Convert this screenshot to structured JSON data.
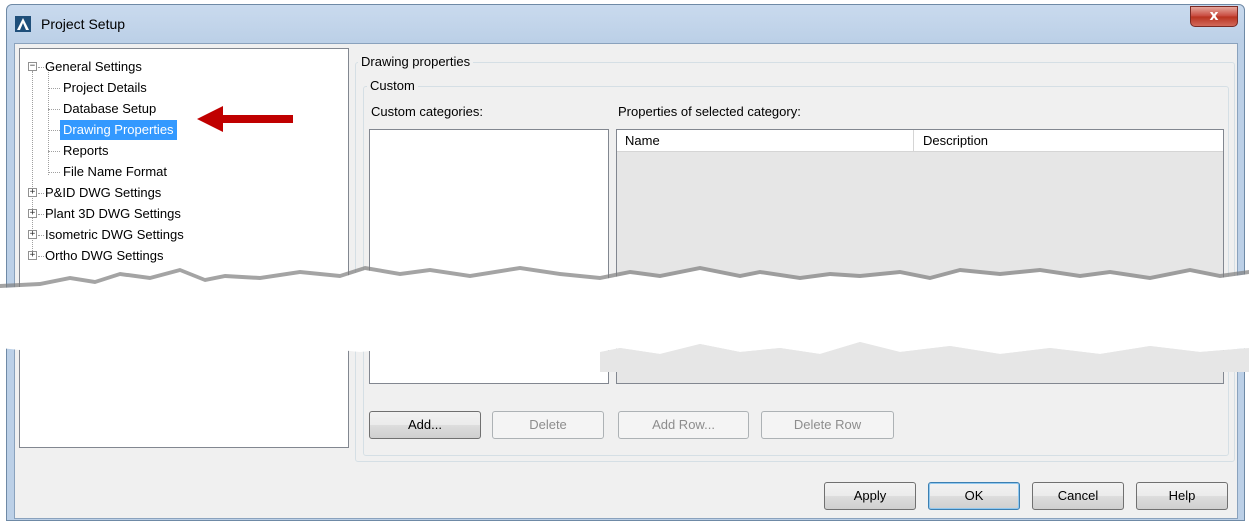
{
  "window": {
    "title": "Project Setup",
    "close_label": "x",
    "app_icon": "autocad-icon",
    "close_icon": "close-icon"
  },
  "tree": {
    "items": [
      {
        "label": "General Settings",
        "level": 0,
        "expander": "−"
      },
      {
        "label": "Project Details",
        "level": 1
      },
      {
        "label": "Database Setup",
        "level": 1
      },
      {
        "label": "Drawing Properties",
        "level": 1,
        "selected": true
      },
      {
        "label": "Reports",
        "level": 1
      },
      {
        "label": "File Name Format",
        "level": 1
      },
      {
        "label": "P&ID DWG Settings",
        "level": 0,
        "expander": "+"
      },
      {
        "label": "Plant 3D DWG Settings",
        "level": 0,
        "expander": "+"
      },
      {
        "label": "Isometric DWG Settings",
        "level": 0,
        "expander": "+"
      },
      {
        "label": "Ortho DWG Settings",
        "level": 0,
        "expander": "+"
      }
    ]
  },
  "annotation": {
    "arrow_color": "#c00000",
    "arrow_icon": "red-arrow-icon"
  },
  "panel": {
    "title": "Drawing properties",
    "group": "Custom",
    "categories_label": "Custom categories:",
    "properties_label": "Properties of selected category:",
    "columns": [
      "Name",
      "Description"
    ]
  },
  "buttons": {
    "add": "Add...",
    "delete": "Delete",
    "add_row": "Add Row...",
    "delete_row": "Delete Row"
  },
  "footer": {
    "apply": "Apply",
    "ok": "OK",
    "cancel": "Cancel",
    "help": "Help"
  },
  "colors": {
    "selection": "#3399ff",
    "accent": "#c00000"
  }
}
